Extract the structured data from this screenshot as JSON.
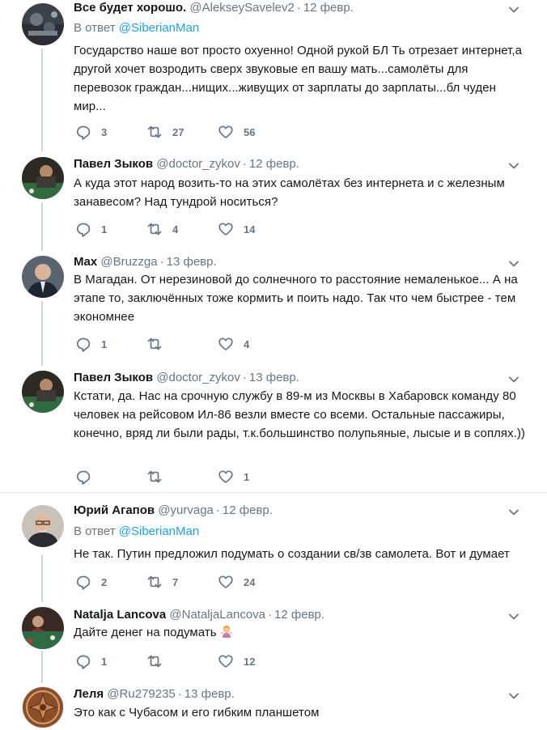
{
  "tweets": [
    {
      "name": "Все будет хорошо.",
      "handle": "@AlekseySavelev2",
      "date": "12 февр.",
      "reply_prefix": "В ответ",
      "reply_to": "@SiberianMan",
      "text": "Государство наше вот просто охуенно! Одной рукой БЛ  Ть отрезает интернет,а другой хочет возродить сверх звуковые еп вашу мать...самолёты для перевозок граждан...нищих...живущих от зарплаты до зарплаты...бл чуден мир...",
      "replies": "3",
      "retweets": "27",
      "likes": "56",
      "avatar_icon": "scene-avatar"
    },
    {
      "name": "Павел Зыков",
      "handle": "@doctor_zykov",
      "date": "12 февр.",
      "text": "А куда этот народ возить-то на этих самолётах без интернета и с железным занавесом? Над тундрой носиться?",
      "replies": "1",
      "retweets": "4",
      "likes": "14",
      "avatar_icon": "billiards-avatar"
    },
    {
      "name": "Max",
      "handle": "@Bruzzga",
      "date": "13 февр.",
      "text": "В Магадан. От нерезиновой до солнечного то расстояние немаленькое... А на этапе то, заключённых тоже кормить и поить надо. Так что чем быстрее - тем экономнее",
      "replies": "1",
      "retweets": "",
      "likes": "4",
      "avatar_icon": "portrait-avatar"
    },
    {
      "name": "Павел Зыков",
      "handle": "@doctor_zykov",
      "date": "13 февр.",
      "text": "Кстати, да. Нас на срочную службу в 89-м из Москвы в Хабаровск команду 80 человек на рейсовом Ил-86 везли вместе со всеми. Остальные пассажиры, конечно, вряд ли были рады, т.к.большинство полупьяные, лысые и в соплях.))",
      "replies": "",
      "retweets": "",
      "likes": "1",
      "avatar_icon": "billiards-avatar"
    },
    {
      "name": "Юрий Агапов",
      "handle": "@yurvaga",
      "date": "12 февр.",
      "reply_prefix": "В ответ",
      "reply_to": "@SiberianMan",
      "text": "Не так. Путин предложил подумать о создании св/зв самолета. Вот и думает",
      "replies": "2",
      "retweets": "7",
      "likes": "24",
      "avatar_icon": "man-glasses-avatar"
    },
    {
      "name": "Natalja Lancova",
      "handle": "@NataljaLancova",
      "date": "12 февр.",
      "text": "Дайте денег на подумать",
      "emoji": "woman-shrugging-emoji",
      "replies": "1",
      "retweets": "",
      "likes": "12",
      "avatar_icon": "billiards-table-avatar"
    },
    {
      "name": "Леля",
      "handle": "@Ru279235",
      "date": "13 февр.",
      "text": "Это как с Чубасом и его гибким планшетом",
      "avatar_icon": "ornament-avatar"
    }
  ],
  "separator": "·",
  "colors": {
    "text": "#14171a",
    "secondary": "#657786",
    "link": "#1da1f2",
    "thread_line": "#ccd6dd",
    "divider": "#e6ecf0"
  }
}
